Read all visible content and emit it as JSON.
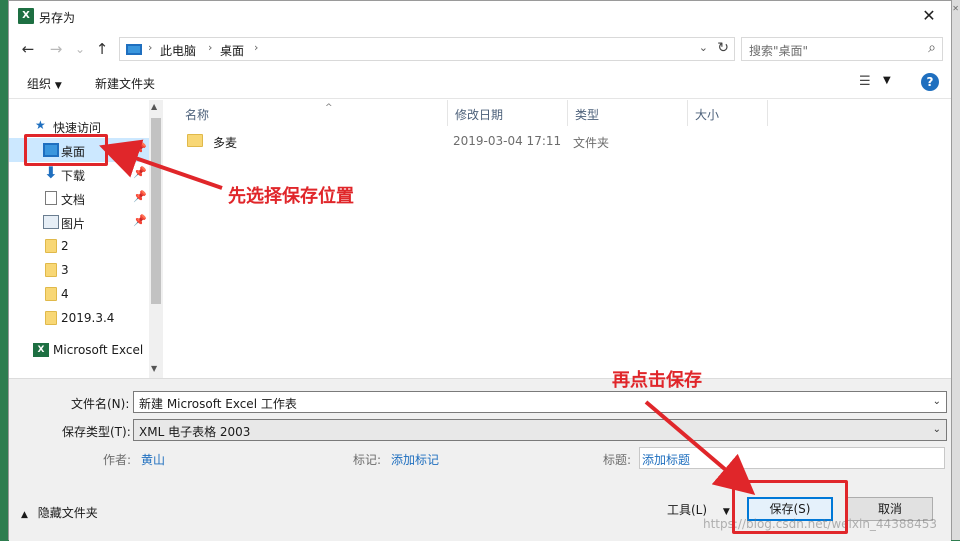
{
  "window": {
    "title": "另存为",
    "app_icon": "excel-icon",
    "close_label": "✕"
  },
  "nav": {
    "back": "←",
    "forward": "→",
    "recent": "⌄",
    "up": "↑",
    "breadcrumb": [
      "此电脑",
      "桌面"
    ],
    "search_placeholder": "搜索\"桌面\""
  },
  "toolbar": {
    "organize": "组织",
    "new_folder": "新建文件夹",
    "help": "?"
  },
  "sidebar": {
    "quick_access": "快速访问",
    "items": [
      {
        "label": "桌面",
        "icon": "desktop-icon",
        "pinned": true,
        "selected": true
      },
      {
        "label": "下载",
        "icon": "download-icon",
        "pinned": true
      },
      {
        "label": "文档",
        "icon": "document-icon",
        "pinned": true
      },
      {
        "label": "图片",
        "icon": "picture-icon",
        "pinned": true
      },
      {
        "label": "2",
        "icon": "folder-icon"
      },
      {
        "label": "3",
        "icon": "folder-icon"
      },
      {
        "label": "4",
        "icon": "folder-icon"
      },
      {
        "label": "2019.3.4",
        "icon": "folder-icon"
      },
      {
        "label": "Microsoft Excel",
        "icon": "excel-icon"
      }
    ]
  },
  "columns": {
    "name": "名称",
    "date": "修改日期",
    "type": "类型",
    "size": "大小"
  },
  "files": [
    {
      "name": "多麦",
      "date": "2019-03-04 17:11",
      "type": "文件夹",
      "icon": "folder-icon"
    }
  ],
  "form": {
    "filename_label": "文件名(N):",
    "filename_value": "新建 Microsoft Excel 工作表",
    "filetype_label": "保存类型(T):",
    "filetype_value": "XML 电子表格 2003",
    "author_label": "作者:",
    "author_value": "黄山",
    "tags_label": "标记:",
    "tags_value": "添加标记",
    "title_label": "标题:",
    "title_value": "添加标题"
  },
  "footer": {
    "hide_folders": "隐藏文件夹",
    "tools": "工具(L)",
    "save": "保存(S)",
    "cancel": "取消"
  },
  "annotations": {
    "step1": "先选择保存位置",
    "step2": "再点击保存",
    "color": "#e0262a"
  },
  "watermark": "https://blog.csdn.net/weixin_44388453"
}
